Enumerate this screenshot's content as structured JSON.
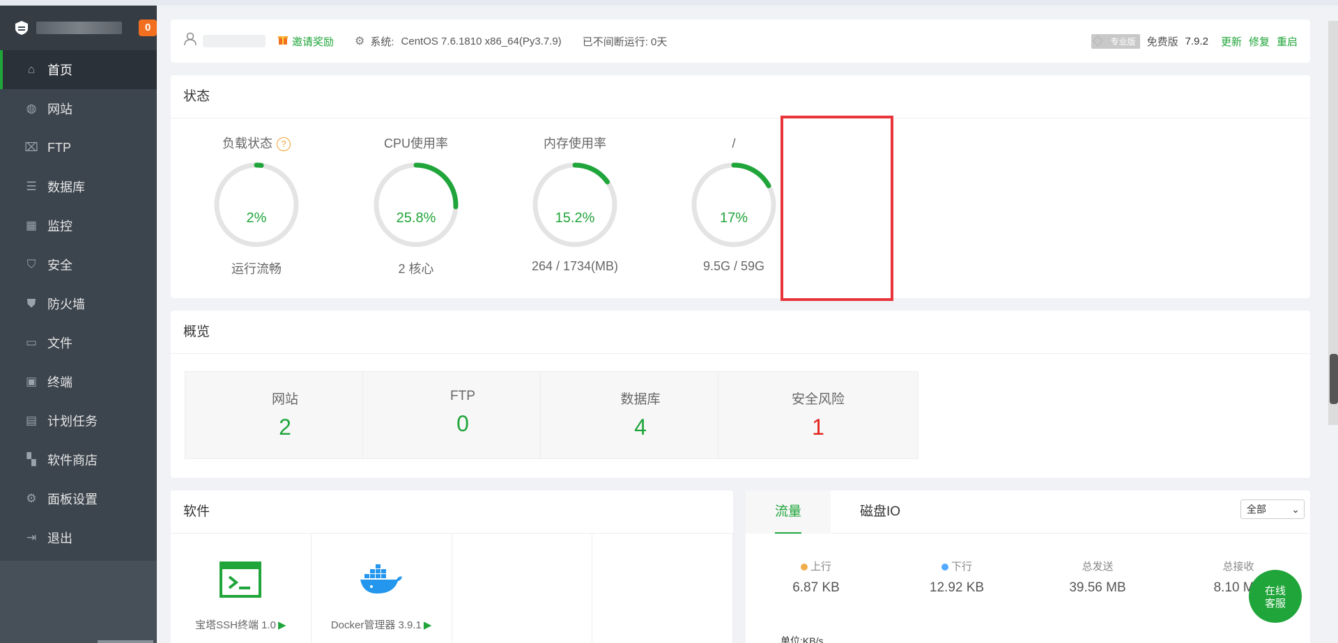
{
  "sidebar": {
    "badge": "0",
    "items": [
      {
        "label": "首页",
        "icon": "home-icon",
        "glyph": "⌂"
      },
      {
        "label": "网站",
        "icon": "globe-icon",
        "glyph": "◍"
      },
      {
        "label": "FTP",
        "icon": "ftp-icon",
        "glyph": "⌧"
      },
      {
        "label": "数据库",
        "icon": "database-icon",
        "glyph": "☰"
      },
      {
        "label": "监控",
        "icon": "monitor-icon",
        "glyph": "▦"
      },
      {
        "label": "安全",
        "icon": "shield-check-icon",
        "glyph": "⛉"
      },
      {
        "label": "防火墙",
        "icon": "firewall-icon",
        "glyph": "⛊"
      },
      {
        "label": "文件",
        "icon": "folder-icon",
        "glyph": "▭"
      },
      {
        "label": "终端",
        "icon": "terminal-icon",
        "glyph": "▣"
      },
      {
        "label": "计划任务",
        "icon": "calendar-icon",
        "glyph": "▤"
      },
      {
        "label": "软件商店",
        "icon": "apps-icon",
        "glyph": "▚"
      },
      {
        "label": "面板设置",
        "icon": "gear-icon",
        "glyph": "⚙"
      },
      {
        "label": "退出",
        "icon": "logout-icon",
        "glyph": "⇥"
      }
    ]
  },
  "header": {
    "invite": "邀请奖励",
    "system_label": "系统:",
    "system_value": "CentOS 7.6.1810 x86_64(Py3.7.9)",
    "uptime": "已不间断运行: 0天",
    "pro_tag": "专业版",
    "free_edition": "免费版",
    "version": "7.9.2",
    "update": "更新",
    "repair": "修复",
    "restart": "重启"
  },
  "status": {
    "title": "状态",
    "gauges": [
      {
        "title": "负载状态",
        "value": "2%",
        "percent": 2,
        "sub": "运行流畅",
        "help": "?"
      },
      {
        "title": "CPU使用率",
        "value": "25.8%",
        "percent": 25.8,
        "sub": "2 核心"
      },
      {
        "title": "内存使用率",
        "value": "15.2%",
        "percent": 15.2,
        "sub": "264 / 1734(MB)"
      },
      {
        "title": "/",
        "value": "17%",
        "percent": 17,
        "sub": "9.5G / 59G"
      }
    ]
  },
  "overview": {
    "title": "概览",
    "items": [
      {
        "label": "网站",
        "value": "2"
      },
      {
        "label": "FTP",
        "value": "0"
      },
      {
        "label": "数据库",
        "value": "4"
      },
      {
        "label": "安全风险",
        "value": "1"
      }
    ]
  },
  "software": {
    "title": "软件",
    "items": [
      {
        "label": "宝塔SSH终端 1.0",
        "icon": "ssh-terminal-icon"
      },
      {
        "label": "Docker管理器 3.9.1",
        "icon": "docker-icon"
      }
    ]
  },
  "traffic": {
    "tabs": [
      "流量",
      "磁盘IO"
    ],
    "select_value": "全部",
    "stats": [
      {
        "label": "上行",
        "value": "6.87 KB",
        "dot": "#f0ad4e"
      },
      {
        "label": "下行",
        "value": "12.92 KB",
        "dot": "#52a9ff"
      },
      {
        "label": "总发送",
        "value": "39.56 MB"
      },
      {
        "label": "总接收",
        "value": "8.10 MB"
      }
    ],
    "unit": "单位:KB/s"
  },
  "chat": {
    "line1": "在线",
    "line2": "客服"
  },
  "colors": {
    "accent": "#20a53a",
    "danger": "#e2231a",
    "sidebar": "#3c444d",
    "highlight": "#e8353c"
  }
}
